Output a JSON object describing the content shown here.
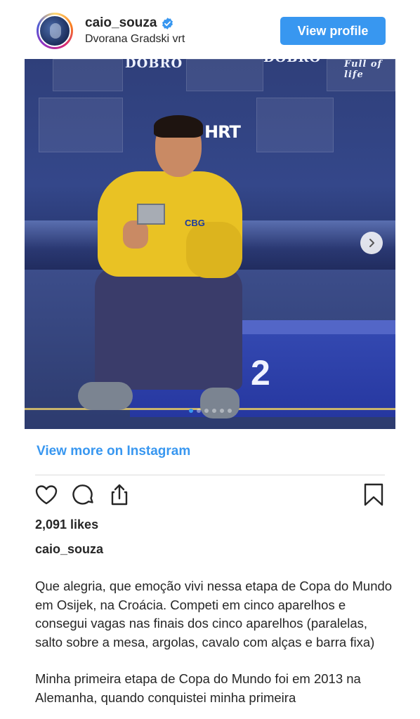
{
  "header": {
    "username": "caio_souza",
    "location": "Dvorana Gradski vrt",
    "view_profile_label": "View profile",
    "verified_icon": "verified-badge-icon"
  },
  "media": {
    "wall_text_1": "DOBRO",
    "wall_text_2": "DOBRO",
    "wall_text_3": "Full of life",
    "wall_text_4": "HRT",
    "podium_number": "2",
    "cbg_text": "CBG",
    "carousel_dots": 6,
    "carousel_active_index": 0
  },
  "view_more_label": "View more on Instagram",
  "actions": {
    "like_icon": "heart-icon",
    "comment_icon": "comment-icon",
    "share_icon": "share-icon",
    "save_icon": "bookmark-icon"
  },
  "likes_text": "2,091 likes",
  "caption": {
    "username": "caio_souza",
    "paragraph_1": "Que alegria, que emoção vivi nessa etapa de Copa do Mundo em Osijek, na Croácia. Competi em cinco aparelhos e consegui vagas nas finais dos cinco aparelhos (paralelas, salto sobre a mesa, argolas, cavalo com alças e barra fixa)",
    "paragraph_2": "Minha primeira etapa de Copa do Mundo foi em 2013 na Alemanha, quando conquistei minha primeira"
  },
  "colors": {
    "accent": "#3897f0",
    "text": "#262626",
    "divider": "#dbdbdb"
  }
}
